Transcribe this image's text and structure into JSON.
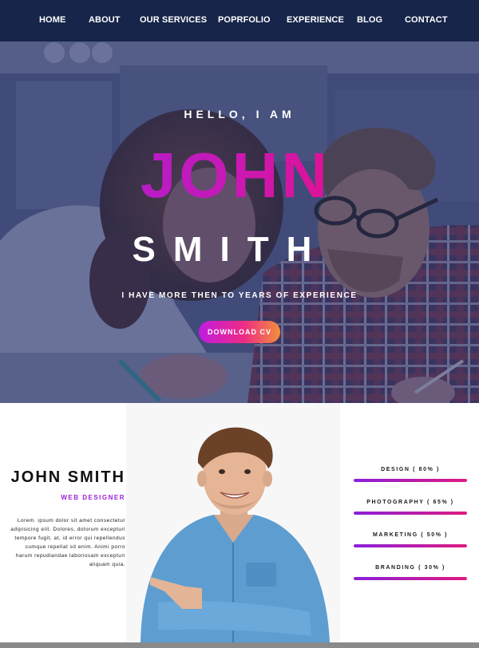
{
  "nav": {
    "items": [
      {
        "label": "HOME"
      },
      {
        "label": "ABOUT"
      },
      {
        "label": "OUR SERVICES"
      },
      {
        "label": "POPRFOLIO"
      },
      {
        "label": "EXPERIENCE"
      },
      {
        "label": "BLOG"
      },
      {
        "label": "CONTACT"
      }
    ]
  },
  "hero": {
    "greeting": "HELLO, I AM",
    "first_name": "JOHN",
    "last_name": "SMITH",
    "tagline": "I HAVE MORE THEN TO YEARS OF EXPERIENCE",
    "cta_label": "DOWNLOAD CV"
  },
  "about": {
    "name": "JOHN SMITH",
    "role": "WEB DESIGNER",
    "bio": "Lorem. ipsum dolor sit amet consectetur adipisicing elit. Dolores, dolorum excepturi tempore fugit, at, id error qui repellendus cumque repellat sit enim. Animi porro harum repudiandae laboriosam excepturi aliquam quia."
  },
  "skills": [
    {
      "label": "DESIGN ( 80% )",
      "level": 80
    },
    {
      "label": "PHOTOGRAPHY ( 65% )",
      "level": 65
    },
    {
      "label": "MARKETING ( 50% )",
      "level": 50
    },
    {
      "label": "BRANDING ( 30% )",
      "level": 30
    }
  ],
  "colors": {
    "nav_bg": "#162549",
    "accent_purple": "#9b1fd6",
    "accent_pink": "#ff0a6c",
    "accent_orange": "#f28f3a"
  }
}
